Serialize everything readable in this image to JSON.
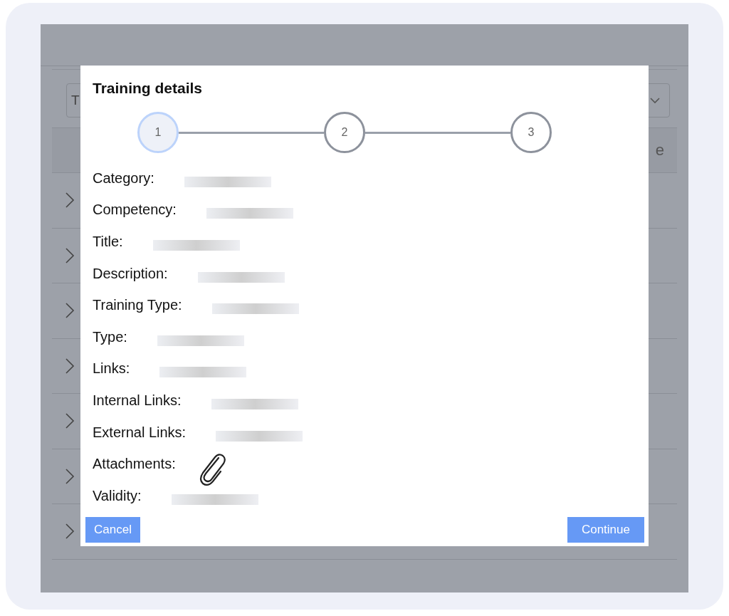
{
  "background": {
    "filter_field": {
      "value": "T"
    },
    "table_header": {
      "column_text": "e"
    },
    "rows": [
      {
        "expanded": false
      },
      {
        "expanded": false
      },
      {
        "expanded": false
      },
      {
        "expanded": false
      },
      {
        "expanded": false
      },
      {
        "expanded": false
      },
      {
        "expanded": false
      }
    ]
  },
  "dialog": {
    "title": "Training details",
    "steps": [
      {
        "label": "1",
        "selected": true
      },
      {
        "label": "2",
        "selected": false
      },
      {
        "label": "3",
        "selected": false
      }
    ],
    "fields": [
      {
        "label": "Category:",
        "kind": "redacted"
      },
      {
        "label": "Competency:",
        "kind": "redacted"
      },
      {
        "label": "Title:",
        "kind": "redacted"
      },
      {
        "label": "Description:",
        "kind": "redacted"
      },
      {
        "label": "Training Type:",
        "kind": "redacted"
      },
      {
        "label": "Type:",
        "kind": "redacted"
      },
      {
        "label": "Links:",
        "kind": "redacted"
      },
      {
        "label": "Internal Links:",
        "kind": "redacted"
      },
      {
        "label": "External Links:",
        "kind": "redacted"
      },
      {
        "label": "Attachments:",
        "kind": "attachment"
      },
      {
        "label": "Validity:",
        "kind": "redacted"
      }
    ],
    "buttons": {
      "cancel": "Cancel",
      "continue": "Continue"
    }
  }
}
